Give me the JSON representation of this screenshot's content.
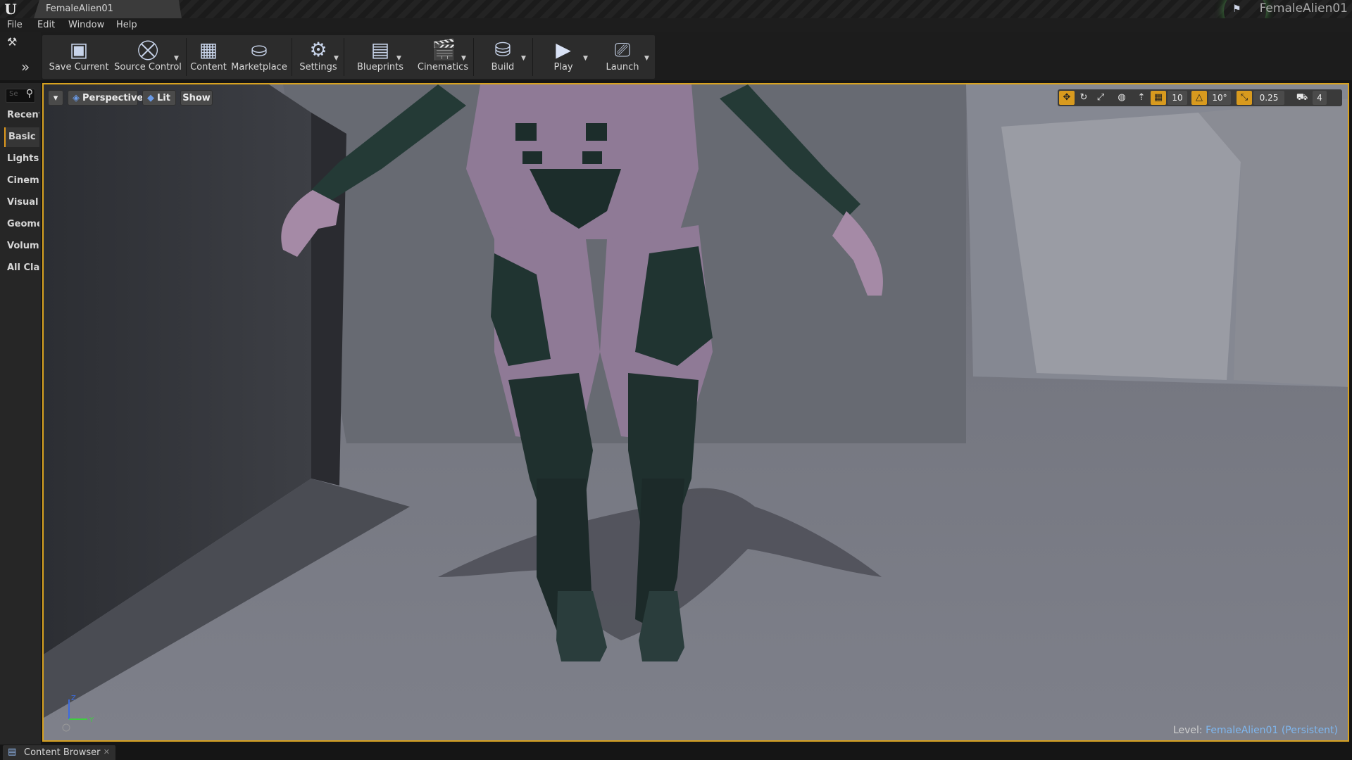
{
  "window": {
    "logo": "U",
    "doc_tab_title": "FemaleAlien01",
    "project_name": "FemaleAlien01"
  },
  "menu": [
    "File",
    "Edit",
    "Window",
    "Help"
  ],
  "toolbar": {
    "buttons": [
      {
        "label": "Save Current",
        "icon": "save-icon"
      },
      {
        "label": "Source Control",
        "icon": "source-control-icon"
      },
      {
        "label": "Content",
        "icon": "content-icon"
      },
      {
        "label": "Marketplace",
        "icon": "marketplace-icon"
      },
      {
        "label": "Settings",
        "icon": "settings-icon"
      },
      {
        "label": "Blueprints",
        "icon": "blueprints-icon"
      },
      {
        "label": "Cinematics",
        "icon": "cinematics-icon"
      },
      {
        "label": "Build",
        "icon": "build-icon"
      },
      {
        "label": "Play",
        "icon": "play-icon"
      },
      {
        "label": "Launch",
        "icon": "launch-icon"
      }
    ]
  },
  "placement": {
    "search_placeholder": "Se",
    "categories": [
      "Recent",
      "Basic",
      "Lights",
      "Cinema",
      "Visual E",
      "Geome",
      "Volume",
      "All Clas"
    ],
    "active_category": "Basic"
  },
  "viewport": {
    "view_mode": "Perspective",
    "lighting": "Lit",
    "show": "Show",
    "grid_snap": "10",
    "rotation_snap": "10°",
    "scale_snap": "0.25",
    "camera_speed": "4",
    "axis_labels": {
      "z": "Z",
      "y": "Y"
    },
    "level_label": "Level:",
    "level_name": "FemaleAlien01 (Persistent)"
  },
  "bottom_tabs": [
    {
      "label": "Content Browser"
    }
  ],
  "colors": {
    "accent": "#d89a1e",
    "level_link": "#7fb7ef"
  }
}
